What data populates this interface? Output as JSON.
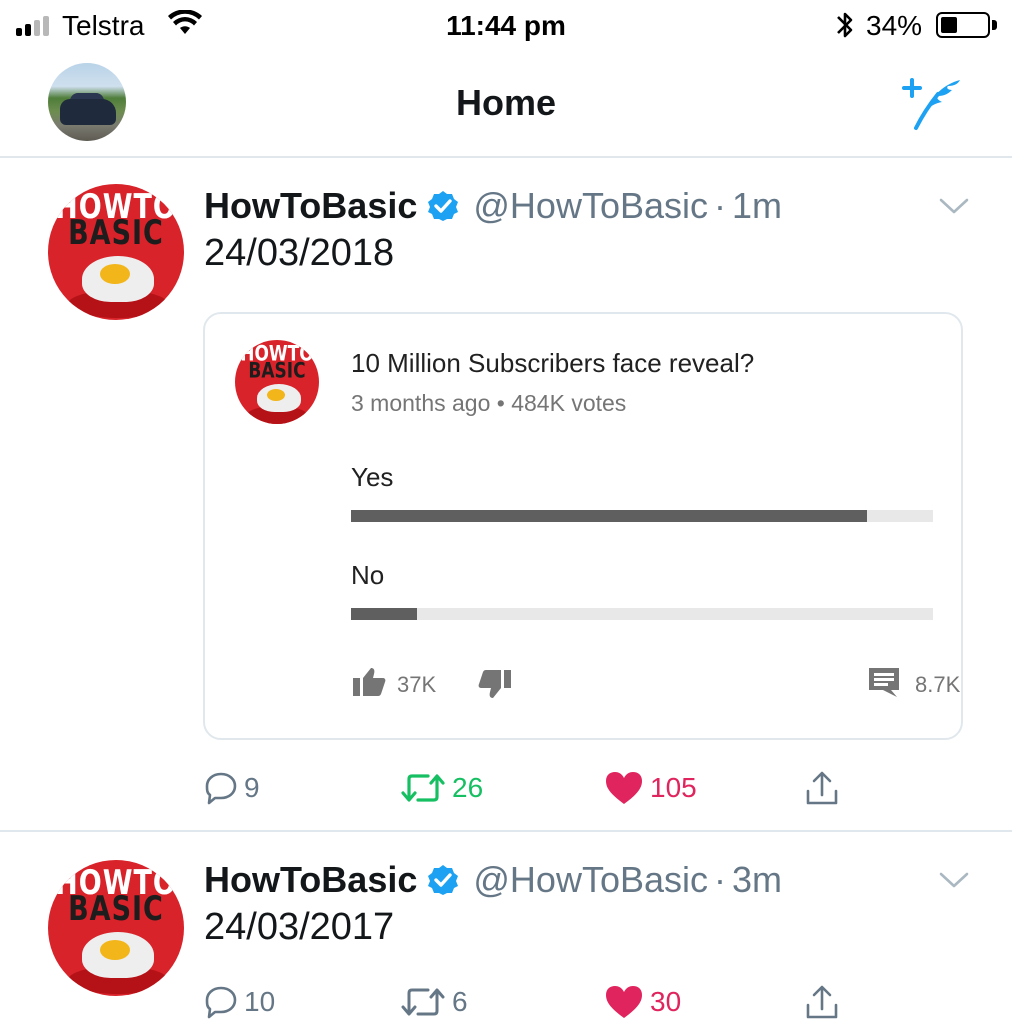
{
  "status_bar": {
    "carrier": "Telstra",
    "time": "11:44 pm",
    "battery_percent": "34%",
    "battery_level": 0.34
  },
  "nav": {
    "title": "Home"
  },
  "tweets": [
    {
      "name": "HowToBasic",
      "handle": "@HowToBasic",
      "time": "1m",
      "text": "24/03/2018",
      "avatar_text": [
        "HOWTO",
        "BASIC"
      ],
      "poll": {
        "question": "10 Million Subscribers face reveal?",
        "age": "3 months ago",
        "votes": "484K votes",
        "options": [
          {
            "label": "Yes",
            "fraction": 0.886
          },
          {
            "label": "No",
            "fraction": 0.114
          }
        ],
        "likes": "37K",
        "comments": "8.7K"
      },
      "replies": "9",
      "retweets": "26",
      "likes": "105",
      "liked": true,
      "retweeted": true
    },
    {
      "name": "HowToBasic",
      "handle": "@HowToBasic",
      "time": "3m",
      "text": "24/03/2017",
      "avatar_text": [
        "HOWTO",
        "BASIC"
      ],
      "replies": "10",
      "retweets": "6",
      "likes": "30",
      "liked": true,
      "retweeted": false
    }
  ],
  "colors": {
    "twitter_blue": "#1da1f2",
    "retweet_green": "#17bf63",
    "like_red": "#e0245e",
    "secondary_text": "#657786",
    "divider": "#e1e8ed"
  },
  "icons": {
    "status": [
      "signal-icon",
      "wifi-icon",
      "bluetooth-icon",
      "battery-icon"
    ],
    "nav": [
      "compose-tweet-icon"
    ],
    "tweet": [
      "verified-badge-icon",
      "chevron-down-icon",
      "reply-icon",
      "retweet-icon",
      "heart-icon",
      "share-icon"
    ],
    "poll": [
      "thumbs-up-icon",
      "thumbs-down-icon",
      "comment-icon"
    ]
  }
}
